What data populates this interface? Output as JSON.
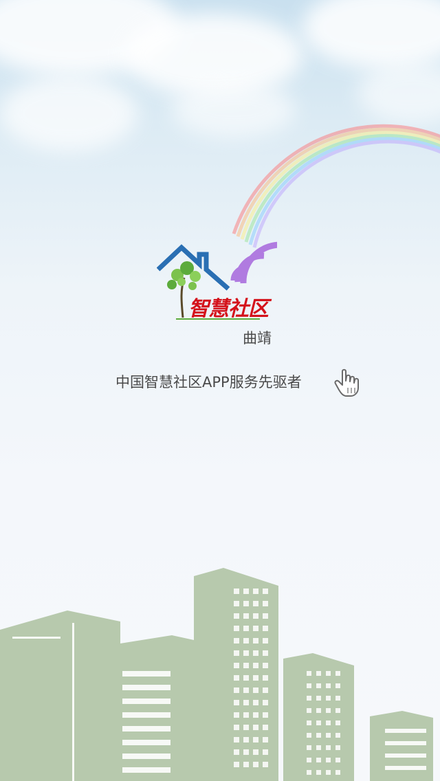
{
  "logo": {
    "title": "智慧社区",
    "subtitle": "曲靖"
  },
  "slogan": "中国智慧社区APP服务先驱者",
  "colors": {
    "logo_text": "#d4121b",
    "roof": "#2a6fb3",
    "wifi": "#b07be0",
    "tree": "#5cab3c",
    "buildings": "#b7c9ad"
  },
  "icons": {
    "cursor": "hand-pointer-icon",
    "wifi": "wifi-signal-icon",
    "house": "house-icon",
    "tree": "tree-icon"
  }
}
